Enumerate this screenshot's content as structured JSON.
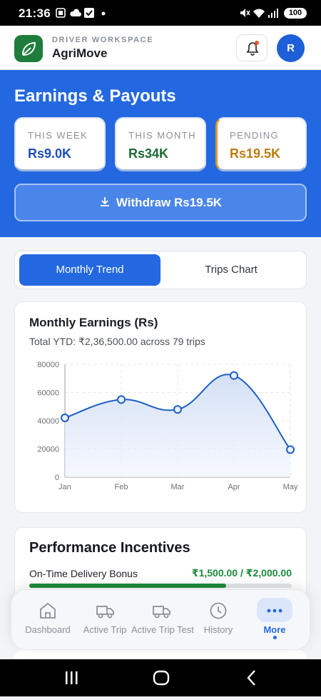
{
  "status_bar": {
    "time": "21:36",
    "battery": "100"
  },
  "header": {
    "workspace_label": "DRIVER WORKSPACE",
    "app_name": "AgriMove",
    "avatar_initial": "R",
    "icons": [
      "leaf-icon",
      "bell-icon"
    ]
  },
  "hero": {
    "title": "Earnings & Payouts",
    "stats": [
      {
        "label": "THIS WEEK",
        "value": "Rs9.0K",
        "color": "#1d4fb8"
      },
      {
        "label": "THIS MONTH",
        "value": "Rs34K",
        "color": "#1a6b35"
      },
      {
        "label": "PENDING",
        "value": "Rs19.5K",
        "color": "#c07c12"
      }
    ],
    "withdraw_label": "Withdraw Rs19.5K"
  },
  "tabs": {
    "active": "Monthly Trend",
    "inactive": "Trips Chart"
  },
  "chart_card": {
    "title": "Monthly Earnings (Rs)",
    "subtitle": "Total YTD: ₹2,36,500.00 across 79 trips"
  },
  "chart_data": {
    "type": "area",
    "categories": [
      "Jan",
      "Feb",
      "Mar",
      "Apr",
      "May"
    ],
    "series": [
      {
        "values": [
          42000,
          55000,
          48000,
          72000,
          19500
        ]
      }
    ],
    "ylim": [
      0,
      80000
    ],
    "yticks": [
      0,
      20000,
      40000,
      60000,
      80000
    ],
    "grid": true,
    "color": "#1d5fc4"
  },
  "incentives": {
    "title": "Performance Incentives",
    "rows": [
      {
        "label": "On-Time Delivery Bonus",
        "value": "₹1,500.00 / ₹2,000.00",
        "progress": 0.75
      }
    ]
  },
  "bottom_nav": {
    "items": [
      {
        "label": "Dashboard",
        "icon": "home-icon"
      },
      {
        "label": "Active Trip",
        "icon": "truck-icon"
      },
      {
        "label": "Active Trip Test",
        "icon": "truck-icon"
      },
      {
        "label": "History",
        "icon": "clock-icon"
      },
      {
        "label": "More",
        "icon": "more-icon",
        "active": true
      }
    ]
  }
}
